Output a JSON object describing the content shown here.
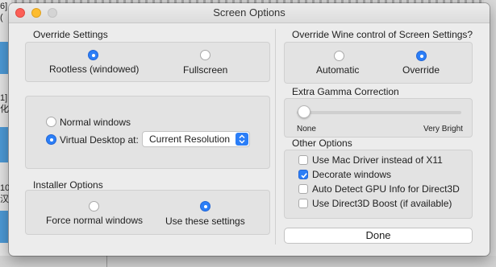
{
  "window": {
    "title": "Screen Options"
  },
  "override_settings": {
    "heading": "Override Settings",
    "options": [
      {
        "label": "Rootless (windowed)",
        "selected": true
      },
      {
        "label": "Fullscreen",
        "selected": false
      }
    ]
  },
  "desktop_settings": {
    "normal_label": "Normal windows",
    "virtual_label": "Virtual Desktop at:",
    "virtual_selected": true,
    "resolution_value": "Current Resolution"
  },
  "installer_options": {
    "heading": "Installer Options",
    "options": [
      {
        "label": "Force normal windows",
        "selected": false
      },
      {
        "label": "Use these settings",
        "selected": true
      }
    ]
  },
  "wine_control": {
    "heading": "Override Wine control of Screen Settings?",
    "options": [
      {
        "label": "Automatic",
        "selected": false
      },
      {
        "label": "Override",
        "selected": true
      }
    ]
  },
  "gamma": {
    "heading": "Extra Gamma Correction",
    "min_label": "None",
    "max_label": "Very Bright",
    "value": 0
  },
  "other_options": {
    "heading": "Other Options",
    "items": [
      {
        "label": "Use Mac Driver instead of X11",
        "checked": false
      },
      {
        "label": "Decorate windows",
        "checked": true
      },
      {
        "label": "Auto Detect GPU Info for Direct3D",
        "checked": false
      },
      {
        "label": "Use Direct3D Boost (if available)",
        "checked": false
      }
    ]
  },
  "done_label": "Done",
  "background": {
    "fragments": [
      "6]",
      "(",
      "1]",
      "化",
      "10",
      "汉"
    ]
  },
  "colors": {
    "accent": "#2b7ef7",
    "window_bg": "#ececec"
  }
}
